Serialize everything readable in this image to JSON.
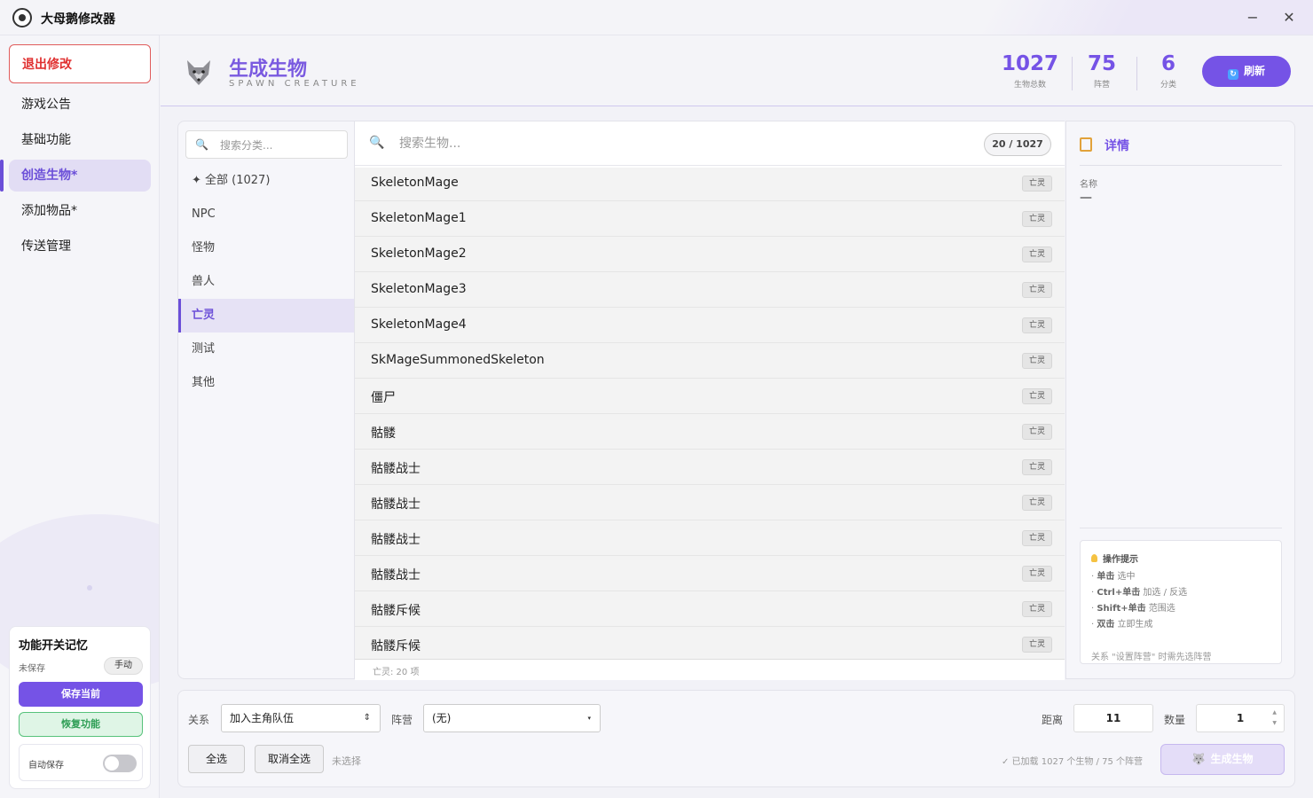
{
  "app": {
    "title": "大母鹅修改器",
    "minimize_glyph": "−",
    "close_glyph": "✕"
  },
  "sidebar": {
    "exit_label": "退出修改",
    "items": [
      {
        "label": "游戏公告"
      },
      {
        "label": "基础功能"
      },
      {
        "label": "创造生物*",
        "active": true
      },
      {
        "label": "添加物品*"
      },
      {
        "label": "传送管理"
      }
    ],
    "memory": {
      "title": "功能开关记忆",
      "status": "未保存",
      "mode_label": "手动",
      "save_label": "保存当前",
      "restore_label": "恢复功能",
      "autosave_label": "自动保存",
      "autosave_on": false
    }
  },
  "header": {
    "icon": "wolf-icon",
    "title": "生成生物",
    "subtitle": "SPAWN CREATURE",
    "stats": [
      {
        "value": "1027",
        "label": "生物总数"
      },
      {
        "value": "75",
        "label": "阵营"
      },
      {
        "value": "6",
        "label": "分类"
      }
    ],
    "refresh_label": "刷新"
  },
  "categories": {
    "search_placeholder": "搜索分类...",
    "items": [
      {
        "label": "✦ 全部 (1027)"
      },
      {
        "label": "NPC"
      },
      {
        "label": "怪物"
      },
      {
        "label": "兽人"
      },
      {
        "label": "亡灵",
        "active": true
      },
      {
        "label": "测试"
      },
      {
        "label": "其他"
      }
    ]
  },
  "list": {
    "search_placeholder": "搜索生物...",
    "count": "20 / 1027",
    "rows": [
      {
        "name": "SkeletonMage",
        "tag": "亡灵"
      },
      {
        "name": "SkeletonMage1",
        "tag": "亡灵"
      },
      {
        "name": "SkeletonMage2",
        "tag": "亡灵"
      },
      {
        "name": "SkeletonMage3",
        "tag": "亡灵"
      },
      {
        "name": "SkeletonMage4",
        "tag": "亡灵"
      },
      {
        "name": "SkMageSummonedSkeleton",
        "tag": "亡灵"
      },
      {
        "name": "僵尸",
        "tag": "亡灵"
      },
      {
        "name": "骷髅",
        "tag": "亡灵"
      },
      {
        "name": "骷髅战士",
        "tag": "亡灵"
      },
      {
        "name": "骷髅战士",
        "tag": "亡灵"
      },
      {
        "name": "骷髅战士",
        "tag": "亡灵"
      },
      {
        "name": "骷髅战士",
        "tag": "亡灵"
      },
      {
        "name": "骷髅斥候",
        "tag": "亡灵"
      },
      {
        "name": "骷髅斥候",
        "tag": "亡灵"
      }
    ],
    "footer": "亡灵: 20 项"
  },
  "detail": {
    "title": "详情",
    "name_label": "名称",
    "name_value": "—",
    "hints_title": "操作提示",
    "hints": [
      {
        "key": "单击",
        "desc": " 选中"
      },
      {
        "key": "Ctrl+单击",
        "desc": " 加选 / 反选"
      },
      {
        "key": "Shift+单击",
        "desc": " 范围选"
      },
      {
        "key": "双击",
        "desc": " 立即生成"
      }
    ],
    "hint_note": "关系 \"设置阵营\" 时需先选阵营"
  },
  "bottom": {
    "relation_label": "关系",
    "relation_value": "加入主角队伍",
    "faction_label": "阵营",
    "faction_value": "(无)",
    "distance_label": "距离",
    "distance_value": "11",
    "quantity_label": "数量",
    "quantity_value": "1",
    "select_all_label": "全选",
    "deselect_all_label": "取消全选",
    "selection_status": "未选择",
    "loaded_status": "✓ 已加载 1027 个生物 / 75 个阵营",
    "spawn_label": "生成生物"
  },
  "colors": {
    "accent": "#7553e6",
    "danger": "#e03030",
    "success": "#2e9e55"
  }
}
